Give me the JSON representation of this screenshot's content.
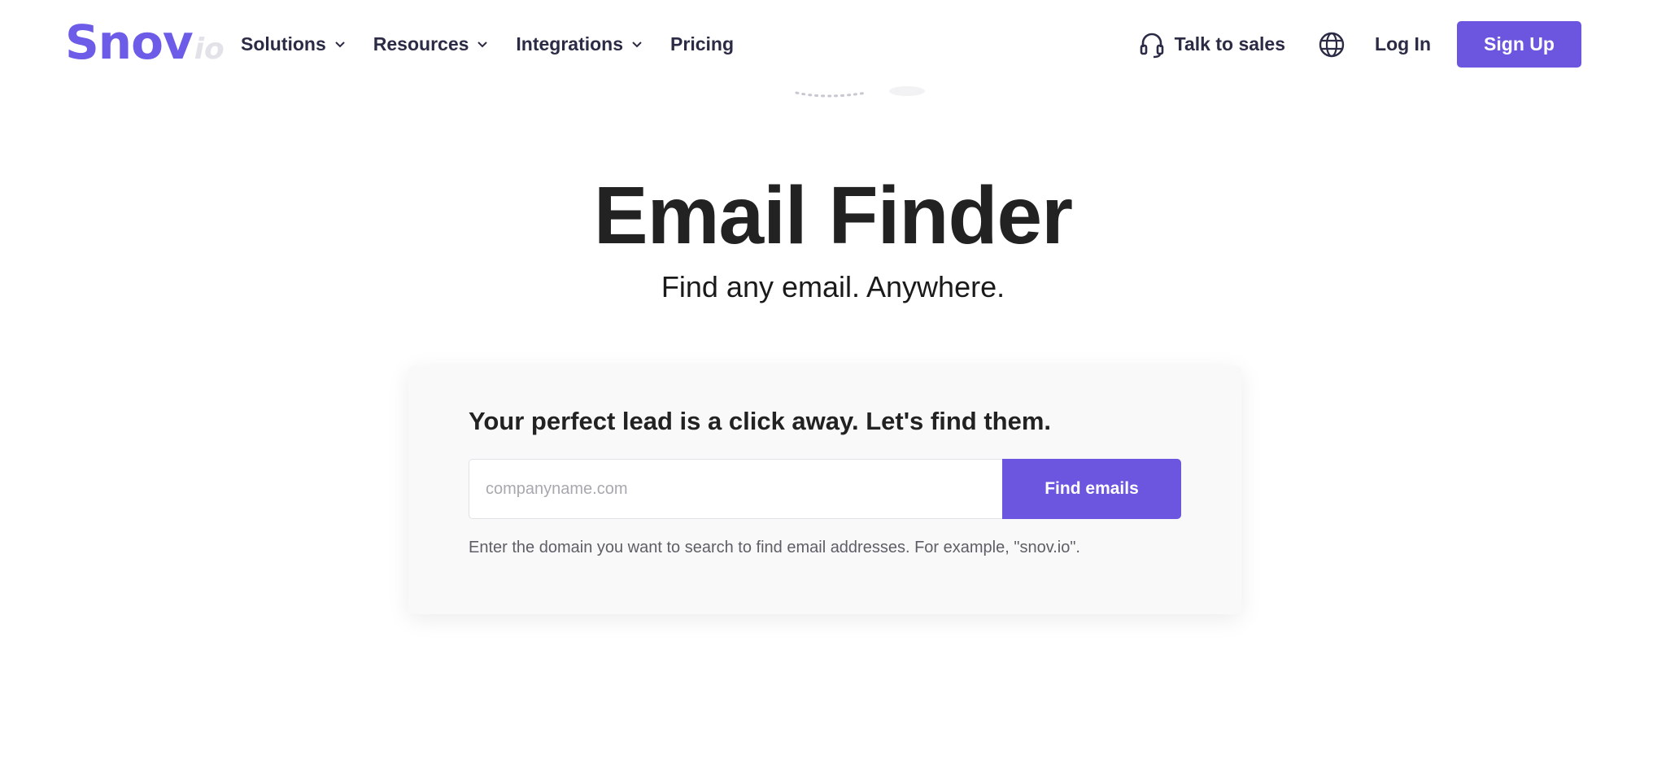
{
  "brand": {
    "name": "Snov",
    "suffix": "io",
    "accent": "#6c56e0"
  },
  "nav": {
    "items": [
      {
        "label": "Solutions",
        "has_dropdown": true
      },
      {
        "label": "Resources",
        "has_dropdown": true
      },
      {
        "label": "Integrations",
        "has_dropdown": true
      },
      {
        "label": "Pricing",
        "has_dropdown": false
      }
    ],
    "talk_to_sales": "Talk to sales",
    "talk_icon": "headset-icon",
    "language_icon": "globe-icon",
    "login": "Log In",
    "signup": "Sign Up"
  },
  "hero": {
    "title": "Email Finder",
    "subtitle": "Find any email. Anywhere."
  },
  "finder": {
    "heading": "Your perfect lead is a click away. Let's find them.",
    "input_placeholder": "companyname.com",
    "input_value": "",
    "button": "Find emails",
    "hint": "Enter the domain you want to search to find email addresses. For example, \"snov.io\"."
  }
}
